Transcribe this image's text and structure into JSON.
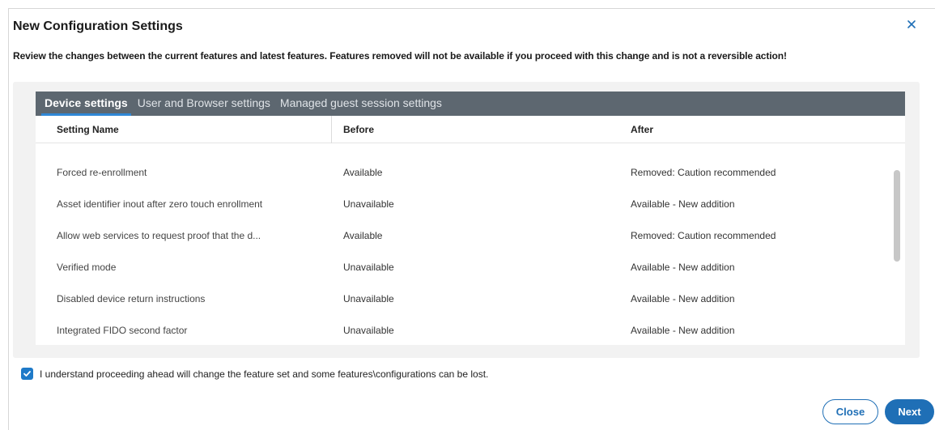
{
  "dialog": {
    "title": "New Configuration Settings",
    "warning": "Review the changes between the current features and latest features. Features removed will not be available if you proceed with this change and is not a reversible action!"
  },
  "tabs": [
    {
      "label": "Device settings",
      "active": true
    },
    {
      "label": "User and Browser settings",
      "active": false
    },
    {
      "label": "Managed guest session settings",
      "active": false
    }
  ],
  "table": {
    "columns": [
      "Setting Name",
      "Before",
      "After"
    ],
    "rows": [
      [
        "Forced re-enrollment",
        "Available",
        "Removed: Caution recommended"
      ],
      [
        "Asset identifier inout after zero touch enrollment",
        "Unavailable",
        "Available - New addition"
      ],
      [
        "Allow web services to request proof that the d...",
        "Available",
        "Removed: Caution recommended"
      ],
      [
        "Verified mode",
        "Unavailable",
        "Available - New addition"
      ],
      [
        "Disabled device return instructions",
        "Unavailable",
        "Available - New addition"
      ],
      [
        "Integrated FIDO second factor",
        "Unavailable",
        "Available - New addition"
      ]
    ]
  },
  "acknowledgement": {
    "checked": true,
    "label": "I understand proceeding ahead will change the feature set and some features\\configurations can be lost."
  },
  "buttons": {
    "close_label": "Close",
    "next_label": "Next"
  },
  "colors": {
    "accent": "#1f6fb6",
    "tab_bar": "#5d6770",
    "active_tab_underline": "#2f87d6"
  }
}
